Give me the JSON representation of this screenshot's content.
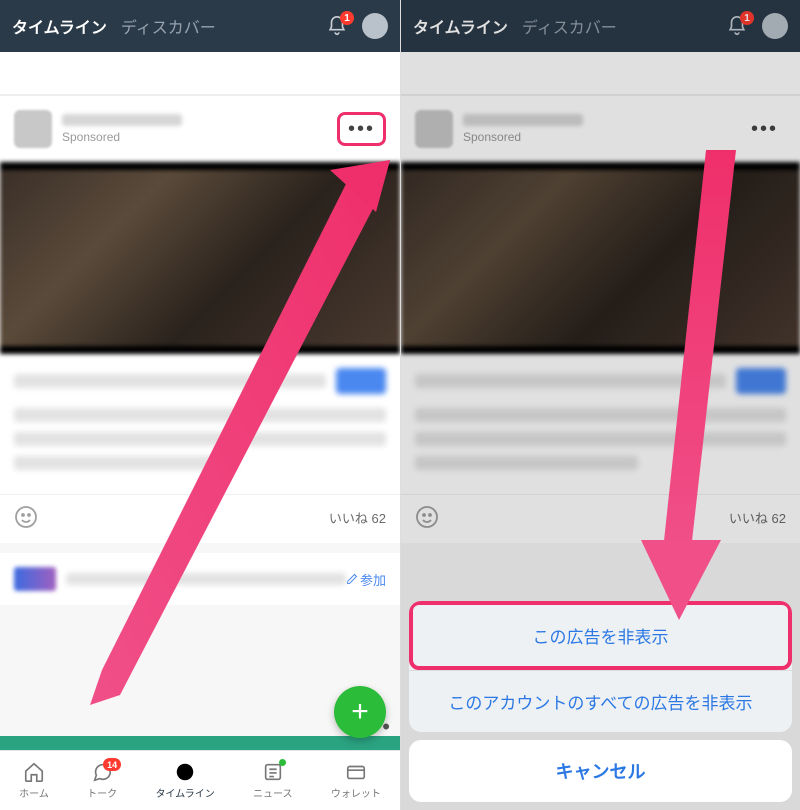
{
  "header": {
    "tab_active": "タイムライン",
    "tab_inactive": "ディスカバー",
    "bell_badge": "1"
  },
  "post": {
    "sponsored": "Sponsored",
    "likes_label": "いいね 62"
  },
  "join_label": "参加",
  "tabbar": {
    "home": "ホーム",
    "talk": "トーク",
    "talk_badge": "14",
    "timeline": "タイムライン",
    "news": "ニュース",
    "wallet": "ウォレット"
  },
  "sheet": {
    "hide_this_ad": "この広告を非表示",
    "hide_all_from_account": "このアカウントのすべての広告を非表示",
    "cancel": "キャンセル"
  }
}
